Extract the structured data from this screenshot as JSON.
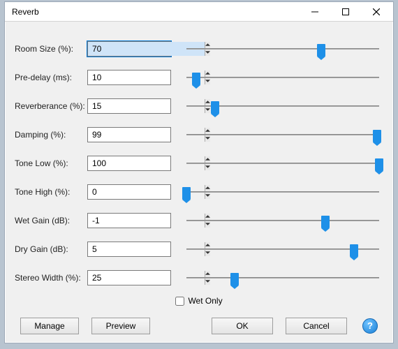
{
  "window": {
    "title": "Reverb"
  },
  "params": [
    {
      "key": "room_size",
      "label": "Room Size (%):",
      "value": "70",
      "pct": 70,
      "focused": true
    },
    {
      "key": "pre_delay",
      "label": "Pre-delay (ms):",
      "value": "10",
      "pct": 5
    },
    {
      "key": "reverberance",
      "label": "Reverberance (%):",
      "value": "15",
      "pct": 15
    },
    {
      "key": "damping",
      "label": "Damping (%):",
      "value": "99",
      "pct": 99
    },
    {
      "key": "tone_low",
      "label": "Tone Low (%):",
      "value": "100",
      "pct": 100
    },
    {
      "key": "tone_high",
      "label": "Tone High (%):",
      "value": "0",
      "pct": 0
    },
    {
      "key": "wet_gain",
      "label": "Wet Gain (dB):",
      "value": "-1",
      "pct": 72
    },
    {
      "key": "dry_gain",
      "label": "Dry Gain (dB):",
      "value": "5",
      "pct": 87
    },
    {
      "key": "stereo_width",
      "label": "Stereo Width (%):",
      "value": "25",
      "pct": 25
    }
  ],
  "wet_only": {
    "label": "Wet Only",
    "checked": false
  },
  "buttons": {
    "manage": "Manage",
    "preview": "Preview",
    "ok": "OK",
    "cancel": "Cancel",
    "help": "?"
  }
}
